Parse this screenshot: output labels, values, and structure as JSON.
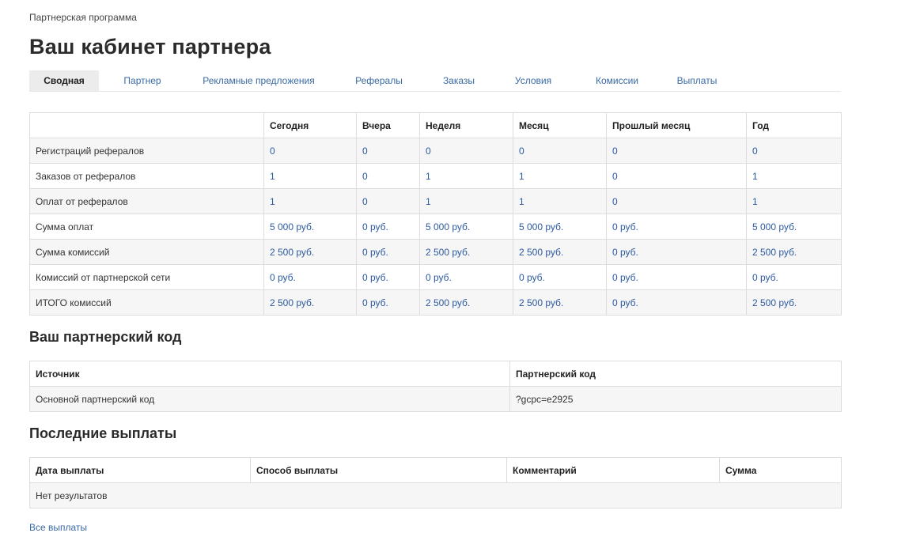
{
  "breadcrumb": "Партнерская программа",
  "page_title": "Ваш кабинет партнера",
  "tabs": [
    {
      "label": "Сводная",
      "active": true
    },
    {
      "label": "Партнер",
      "active": false
    },
    {
      "label": "Рекламные предложения",
      "active": false
    },
    {
      "label": "Рефералы",
      "active": false
    },
    {
      "label": "Заказы",
      "active": false
    },
    {
      "label": "Условия",
      "active": false
    },
    {
      "label": "Комиссии",
      "active": false
    },
    {
      "label": "Выплаты",
      "active": false
    }
  ],
  "stats": {
    "columns": [
      "",
      "Сегодня",
      "Вчера",
      "Неделя",
      "Месяц",
      "Прошлый месяц",
      "Год"
    ],
    "rows": [
      {
        "label": "Регистраций рефералов",
        "values": [
          "0",
          "0",
          "0",
          "0",
          "0",
          "0"
        ]
      },
      {
        "label": "Заказов от рефералов",
        "values": [
          "1",
          "0",
          "1",
          "1",
          "0",
          "1"
        ]
      },
      {
        "label": "Оплат от рефералов",
        "values": [
          "1",
          "0",
          "1",
          "1",
          "0",
          "1"
        ]
      },
      {
        "label": "Сумма оплат",
        "values": [
          "5 000 руб.",
          "0 руб.",
          "5 000 руб.",
          "5 000 руб.",
          "0 руб.",
          "5 000 руб."
        ]
      },
      {
        "label": "Сумма комиссий",
        "values": [
          "2 500 руб.",
          "0 руб.",
          "2 500 руб.",
          "2 500 руб.",
          "0 руб.",
          "2 500 руб."
        ]
      },
      {
        "label": "Комиссий от партнерской сети",
        "values": [
          "0 руб.",
          "0 руб.",
          "0 руб.",
          "0 руб.",
          "0 руб.",
          "0 руб."
        ]
      },
      {
        "label": "ИТОГО комиссий",
        "values": [
          "2 500 руб.",
          "0 руб.",
          "2 500 руб.",
          "2 500 руб.",
          "0 руб.",
          "2 500 руб."
        ]
      }
    ]
  },
  "partner_code": {
    "title": "Ваш партнерский код",
    "columns": [
      "Источник",
      "Партнерский код"
    ],
    "rows": [
      {
        "source": "Основной партнерский код",
        "code": "?gcpc=e2925"
      }
    ]
  },
  "payouts": {
    "title": "Последние выплаты",
    "columns": [
      "Дата выплаты",
      "Способ выплаты",
      "Комментарий",
      "Сумма"
    ],
    "empty_text": "Нет результатов",
    "all_link": "Все выплаты"
  },
  "colors": {
    "link": "#3a6aa5",
    "value": "#2c5aa0",
    "row_stripe": "#f6f6f6",
    "border": "#dddddd",
    "active_tab_bg": "#ececec"
  }
}
